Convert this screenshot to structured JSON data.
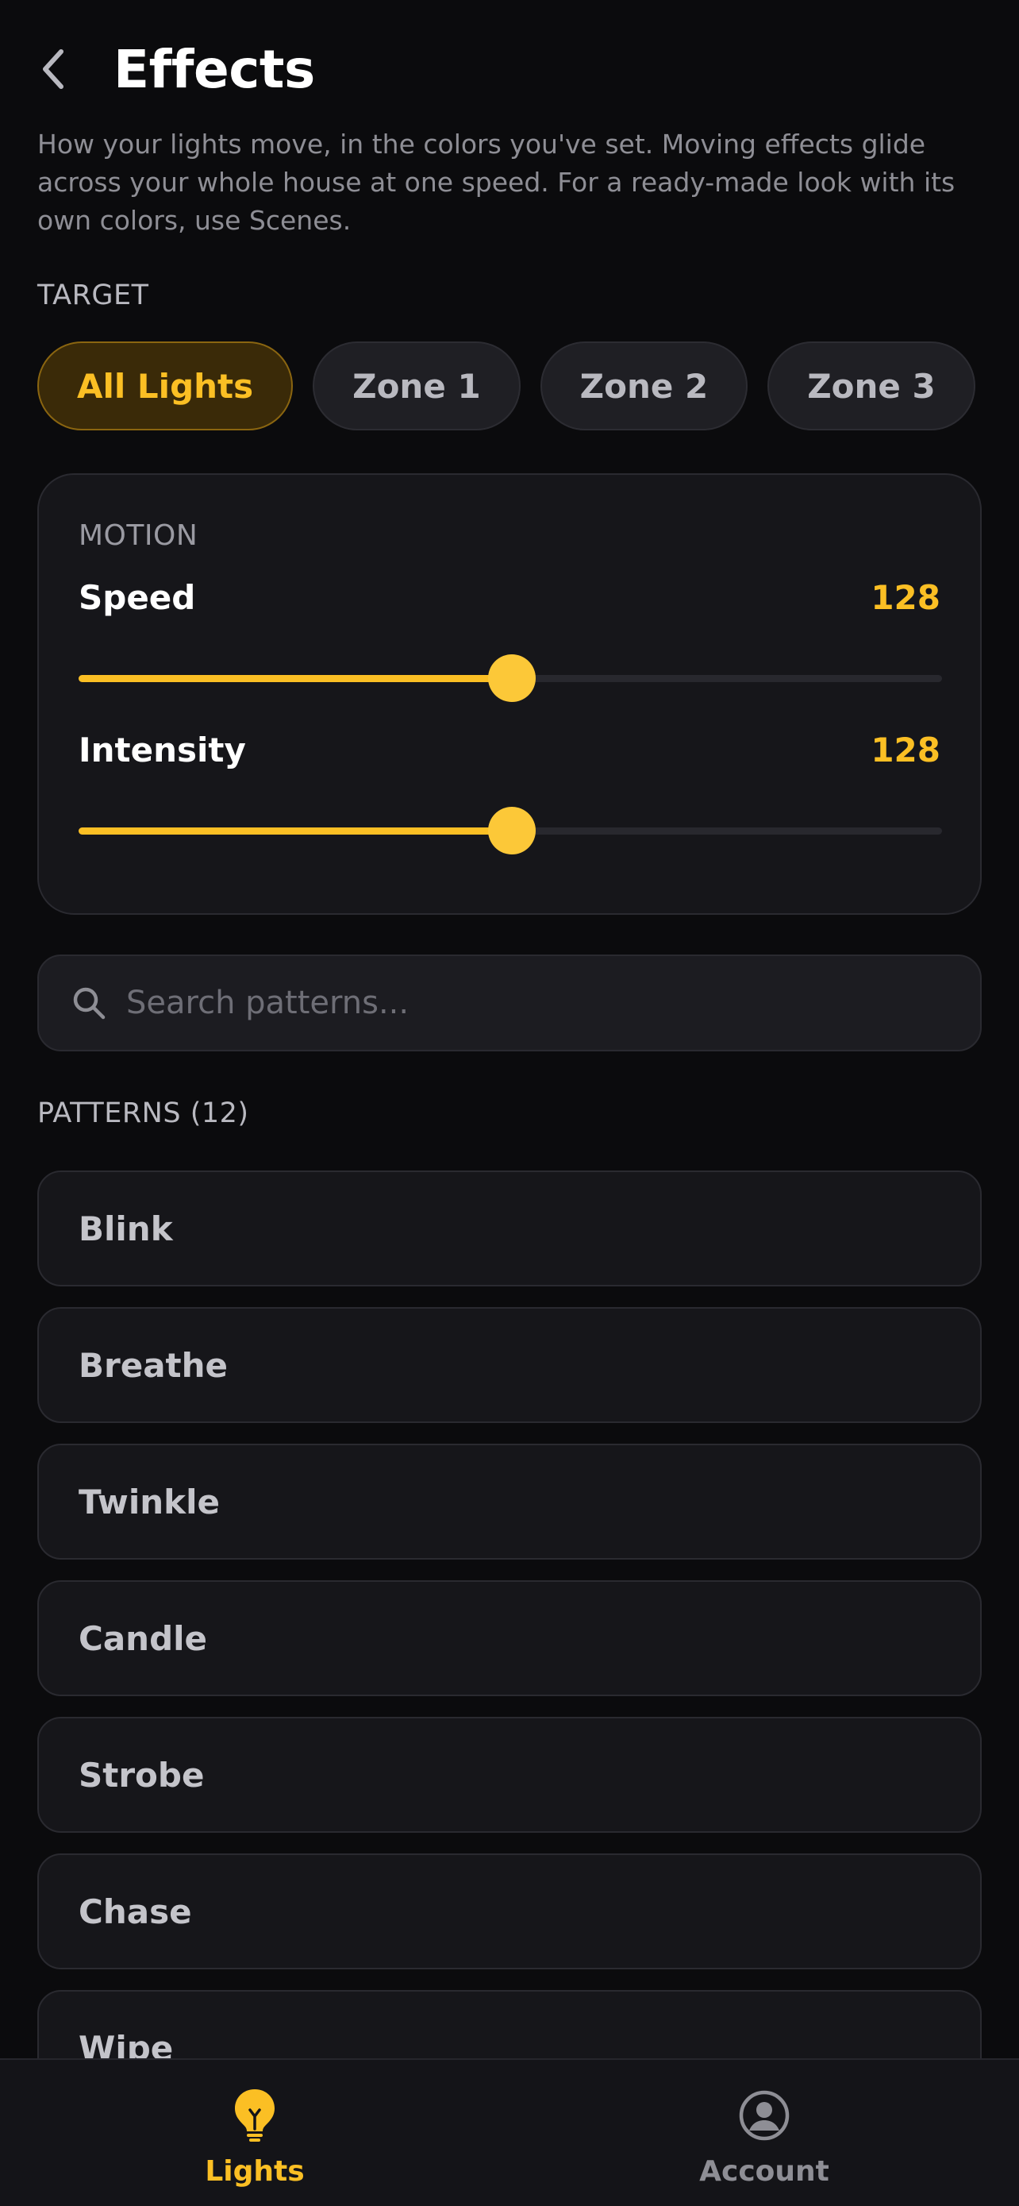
{
  "header": {
    "title": "Effects",
    "back_icon": "chevron-left-icon"
  },
  "description": "How your lights move, in the colors you've set. Moving effects glide across your whole house at one speed. For a ready-made look with its own colors, use Scenes.",
  "target": {
    "label": "TARGET",
    "chips": [
      {
        "label": "All Lights",
        "selected": true
      },
      {
        "label": "Zone 1",
        "selected": false
      },
      {
        "label": "Zone 2",
        "selected": false
      },
      {
        "label": "Zone 3",
        "selected": false
      }
    ]
  },
  "motion": {
    "label": "MOTION",
    "speed": {
      "label": "Speed",
      "value": "128",
      "fraction": 0.502
    },
    "intensity": {
      "label": "Intensity",
      "value": "128",
      "fraction": 0.502
    }
  },
  "search": {
    "placeholder": "Search patterns...",
    "value": "",
    "icon": "search-icon"
  },
  "patterns": {
    "label": "PATTERNS (12)",
    "items": [
      "Blink",
      "Breathe",
      "Twinkle",
      "Candle",
      "Strobe",
      "Chase",
      "Wipe"
    ]
  },
  "bottom_nav": {
    "items": [
      {
        "label": "Lights",
        "icon": "lightbulb-icon",
        "active": true
      },
      {
        "label": "Account",
        "icon": "user-circle-icon",
        "active": false
      }
    ]
  },
  "colors": {
    "accent": "#fbbf24",
    "background": "#0b0b0d",
    "card": "#16161a"
  }
}
